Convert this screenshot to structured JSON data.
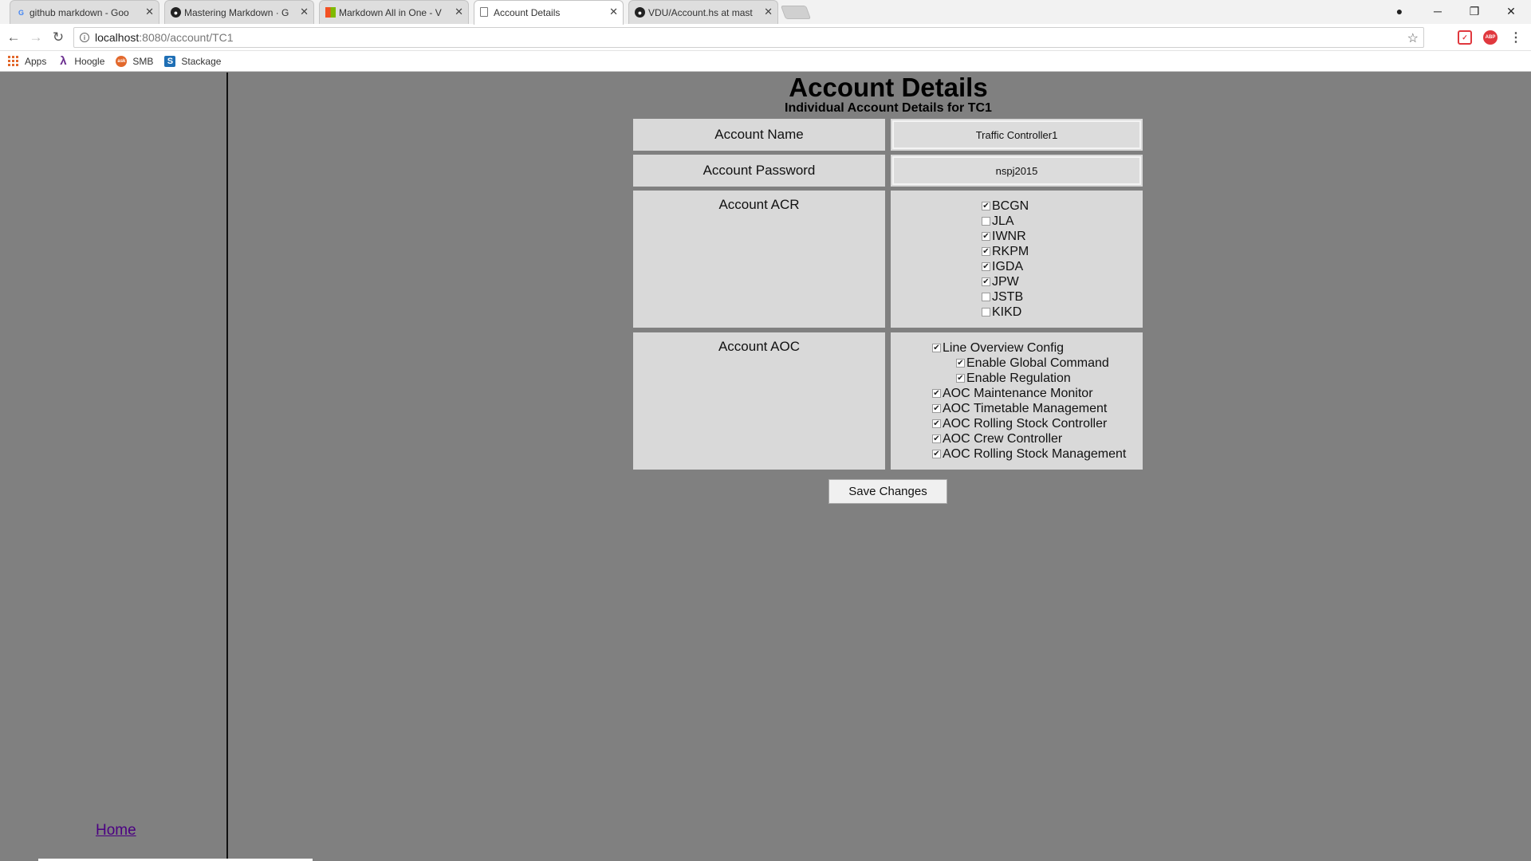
{
  "browser": {
    "tabs": [
      {
        "title": "github markdown - Goo",
        "icon": "google-icon"
      },
      {
        "title": "Mastering Markdown · G",
        "icon": "github-icon"
      },
      {
        "title": "Markdown All in One - V",
        "icon": "microsoft-icon"
      },
      {
        "title": "Account Details",
        "icon": "page-icon"
      },
      {
        "title": "VDU/Account.hs at mast",
        "icon": "github-icon"
      }
    ],
    "url_host": "localhost",
    "url_path": ":8080/account/TC1",
    "bookmarks": [
      {
        "label": "Apps",
        "icon": "apps-grid-icon"
      },
      {
        "label": "Hoogle",
        "icon": "lambda-icon"
      },
      {
        "label": "SMB",
        "icon": "ask-icon"
      },
      {
        "label": "Stackage",
        "icon": "stackage-icon"
      }
    ],
    "extensions": {
      "pocket": "pocket-icon",
      "adblock": "ABP"
    }
  },
  "page": {
    "title": "Account Details",
    "subtitle": "Individual Account Details for TC1",
    "account_name_label": "Account Name",
    "account_name_value": "Traffic Controller1",
    "account_password_label": "Account Password",
    "account_password_value": "nspj2015",
    "acr_label": "Account ACR",
    "acr_items": [
      {
        "label": "BCGN",
        "checked": true
      },
      {
        "label": "JLA",
        "checked": false
      },
      {
        "label": "IWNR",
        "checked": true
      },
      {
        "label": "RKPM",
        "checked": true
      },
      {
        "label": "IGDA",
        "checked": true
      },
      {
        "label": "JPW",
        "checked": true
      },
      {
        "label": "JSTB",
        "checked": false
      },
      {
        "label": "KIKD",
        "checked": false
      }
    ],
    "aoc_label": "Account AOC",
    "aoc_items": [
      {
        "label": "Line Overview Config",
        "checked": true,
        "indent": 0
      },
      {
        "label": "Enable Global Command",
        "checked": true,
        "indent": 1
      },
      {
        "label": "Enable Regulation",
        "checked": true,
        "indent": 1
      },
      {
        "label": "AOC Maintenance Monitor",
        "checked": true,
        "indent": 0
      },
      {
        "label": "AOC Timetable Management",
        "checked": true,
        "indent": 0
      },
      {
        "label": "AOC Rolling Stock Controller",
        "checked": true,
        "indent": 0
      },
      {
        "label": "AOC Crew Controller",
        "checked": true,
        "indent": 0
      },
      {
        "label": "AOC Rolling Stock Management",
        "checked": true,
        "indent": 0
      }
    ],
    "save_label": "Save Changes",
    "home_label": "Home"
  },
  "colors": {
    "background": "#808080",
    "cell": "#d9d9d9",
    "link": "#4b0082"
  }
}
